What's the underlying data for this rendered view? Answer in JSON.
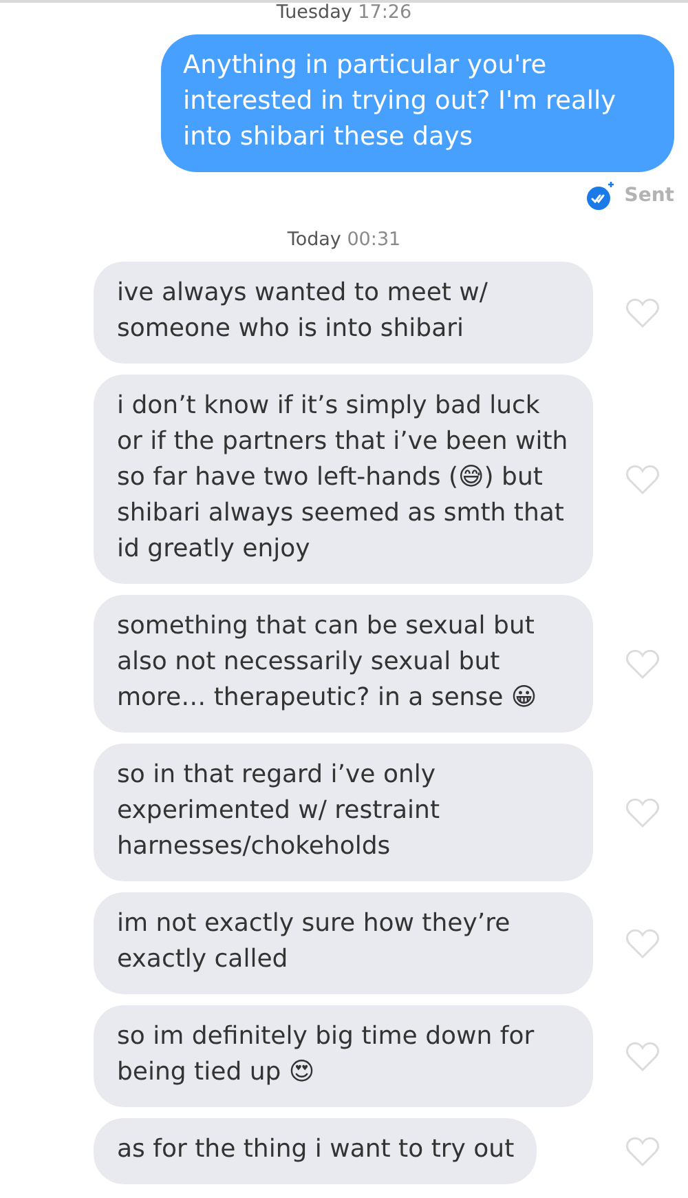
{
  "conversation": [
    {
      "kind": "timestamp",
      "day": "Tuesday",
      "time": "17:26"
    },
    {
      "kind": "sent",
      "text": "Anything in particular you're interested in trying out? I'm really into shibari these days",
      "status": "Sent"
    },
    {
      "kind": "timestamp",
      "day": "Today",
      "time": "00:31"
    },
    {
      "kind": "received",
      "liked": false,
      "text": "ive always wanted to meet w/ someone who is into shibari"
    },
    {
      "kind": "received",
      "liked": false,
      "text": "i don’t know if it’s simply bad luck or if the partners that i’ve been with so far have two left-hands (😅) but shibari always seemed as smth that id greatly enjoy"
    },
    {
      "kind": "received",
      "liked": false,
      "text": "something that can be sexual but also not necessarily sexual but more… therapeutic? in a sense 😀"
    },
    {
      "kind": "received",
      "liked": false,
      "text": "so in that regard i’ve only experimented w/ restraint harnesses/chokeholds"
    },
    {
      "kind": "received",
      "liked": false,
      "text": "im not exactly sure how they’re exactly called"
    },
    {
      "kind": "received",
      "liked": false,
      "text": "so im definitely big time down for being tied up 😍"
    },
    {
      "kind": "received",
      "liked": false,
      "text": "as for the thing i want to try out"
    }
  ]
}
